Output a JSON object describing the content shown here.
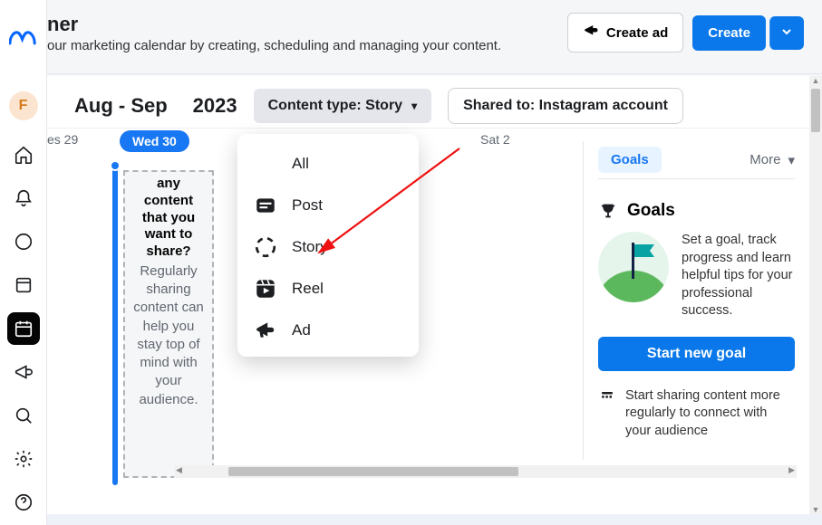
{
  "leftRail": {
    "avatarInitial": "F"
  },
  "banner": {
    "titleSuffix": "ner",
    "subtitlePrefix": "our marketing calendar by creating, scheduling and managing your content.",
    "createAd": "Create ad",
    "create": "Create"
  },
  "filters": {
    "monthRange": "Aug - Sep",
    "year": "2023",
    "contentTypeLabel": "Content type: Story",
    "sharedToLabel": "Shared to: Instagram account"
  },
  "days": {
    "left": "es 29",
    "wed": "Wed 30",
    "sat": "Sat 2"
  },
  "card": {
    "question": "any content that you want to share?",
    "body": "Regularly sharing content can help you stay top of mind with your audience."
  },
  "dropdown": {
    "all": "All",
    "post": "Post",
    "story": "Story",
    "reel": "Reel",
    "ad": "Ad"
  },
  "goals": {
    "tab": "Goals",
    "more": "More",
    "heading": "Goals",
    "desc": "Set a goal, track progress and learn helpful tips for your professional success.",
    "startBtn": "Start new goal",
    "tip": "Start sharing content more regularly to connect with your audience"
  }
}
